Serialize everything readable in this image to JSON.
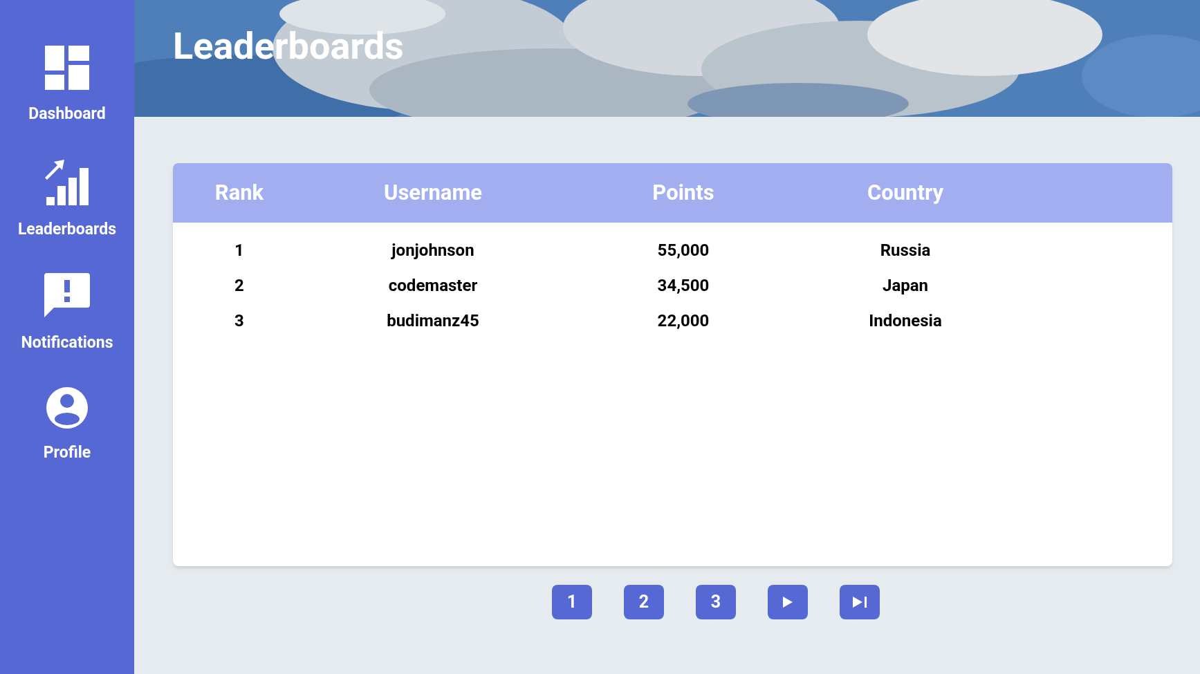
{
  "sidebar": {
    "items": [
      {
        "label": "Dashboard",
        "kind": "dashboard"
      },
      {
        "label": "Leaderboards",
        "kind": "leaderboards"
      },
      {
        "label": "Notifications",
        "kind": "notifications"
      },
      {
        "label": "Profile",
        "kind": "profile"
      }
    ]
  },
  "header": {
    "title": "Leaderboards"
  },
  "table": {
    "columns": [
      "Rank",
      "Username",
      "Points",
      "Country"
    ],
    "rows": [
      [
        "1",
        "jonjohnson",
        "55,000",
        "Russia"
      ],
      [
        "2",
        "codemaster",
        "34,500",
        "Japan"
      ],
      [
        "3",
        "budimanz45",
        "22,000",
        "Indonesia"
      ]
    ]
  },
  "pagination": [
    {
      "kind": "page",
      "label": "1"
    },
    {
      "kind": "page",
      "label": "2"
    },
    {
      "kind": "page",
      "label": "3"
    },
    {
      "kind": "next"
    },
    {
      "kind": "last"
    }
  ]
}
